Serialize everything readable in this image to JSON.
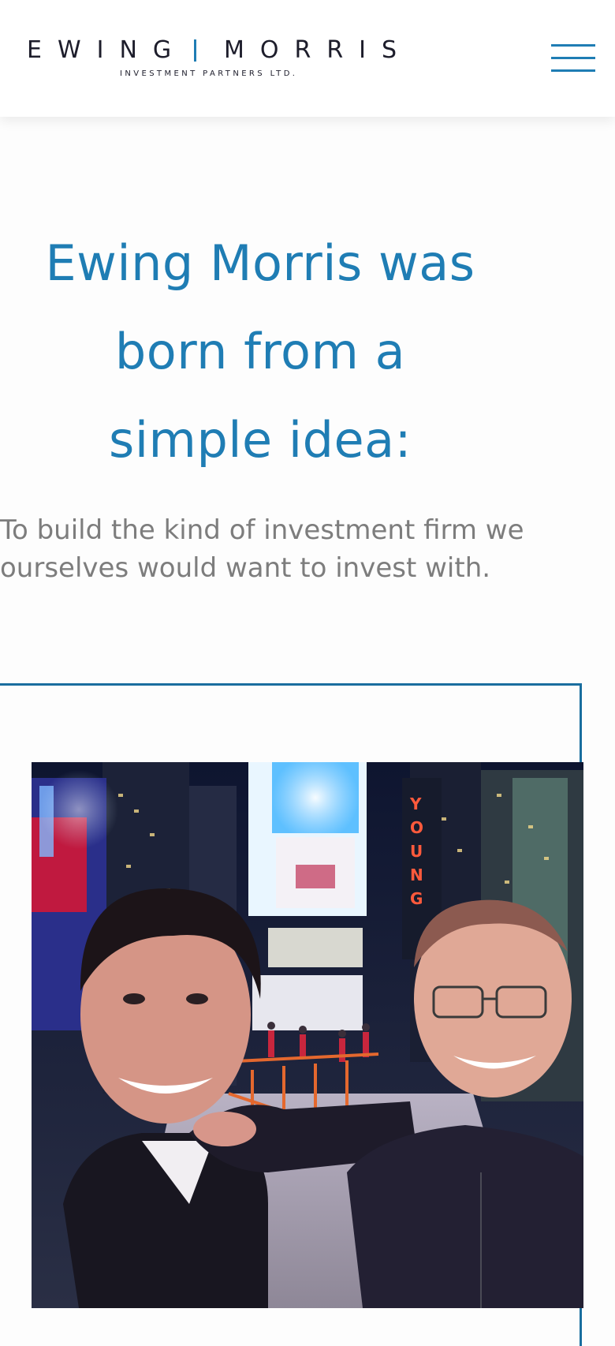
{
  "header": {
    "logo": {
      "word_left": "EWING",
      "word_right": "MORRIS",
      "tagline": "INVESTMENT PARTNERS LTD.",
      "accent_color": "#1f7db4"
    },
    "menu_icon": "hamburger-menu-icon"
  },
  "hero": {
    "title_lines": [
      "Ewing Morris was",
      "born from a",
      "simple idea:"
    ],
    "intro_lines": [
      "To build the kind of investment firm we",
      "ourselves would want to invest with."
    ],
    "title_color": "#1f7db4",
    "text_color": "#7d7d7d"
  },
  "photo": {
    "subject": "founders-selfie-photo",
    "sign_letters": "YOUNG",
    "frame_color": "#1a6e9f"
  }
}
